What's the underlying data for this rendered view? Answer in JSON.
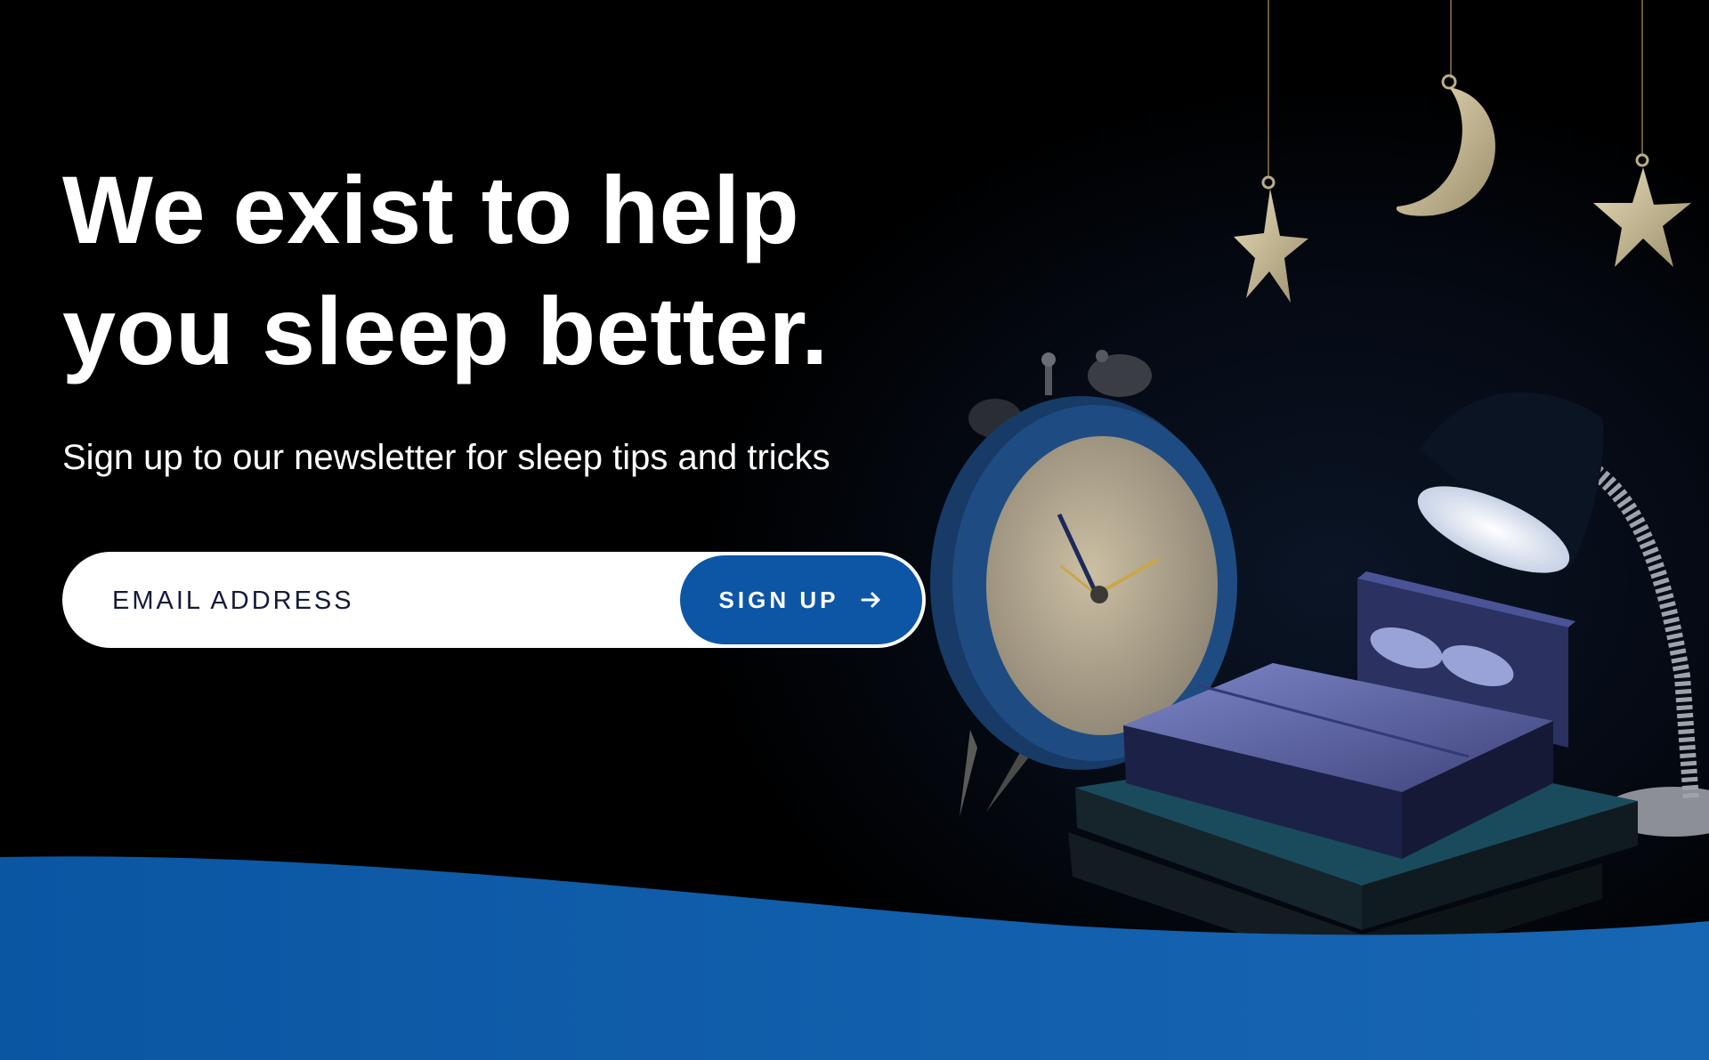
{
  "hero": {
    "headline_line1": "We exist to help",
    "headline_line2": "you sleep better.",
    "subtitle": "Sign up to our newsletter for sleep tips and tricks"
  },
  "signup": {
    "email_placeholder": "EMAIL ADDRESS",
    "button_label": "SIGN UP",
    "button_icon": "arrow-right-icon"
  },
  "colors": {
    "background": "#000000",
    "accent_blue": "#0d56a6",
    "wave_blue": "#0b5cab",
    "text_white": "#ffffff",
    "input_text": "#141a3a"
  },
  "illustration": {
    "objects": [
      "alarm-clock",
      "bed",
      "books",
      "desk-lamp",
      "crescent-moon",
      "hanging-stars"
    ]
  }
}
